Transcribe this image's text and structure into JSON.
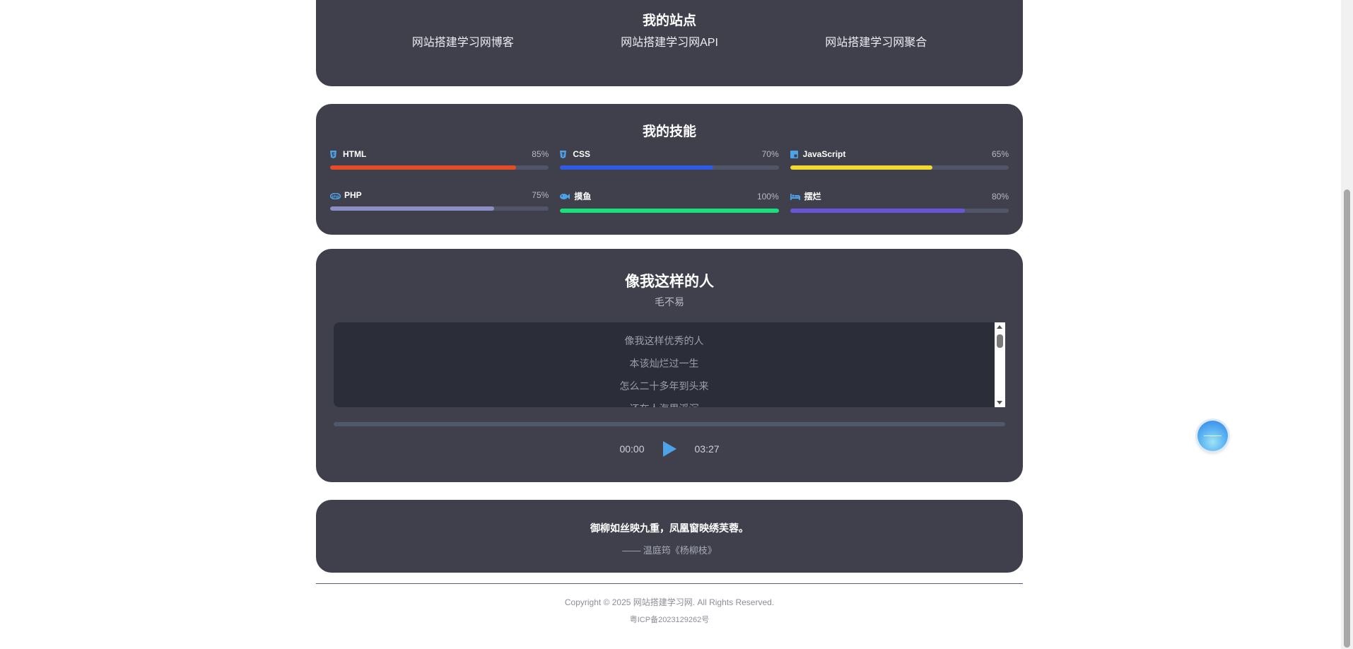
{
  "sites": {
    "title": "我的站点",
    "links": [
      "网站搭建学习网博客",
      "网站搭建学习网API",
      "网站搭建学习网聚合"
    ]
  },
  "skills": {
    "title": "我的技能",
    "items": [
      {
        "name": "HTML",
        "percent_label": "85%",
        "level": 85,
        "color": "#e44d26",
        "icon": "html5-icon"
      },
      {
        "name": "CSS",
        "percent_label": "70%",
        "level": 70,
        "color": "#2d5be3",
        "icon": "css3-icon"
      },
      {
        "name": "JavaScript",
        "percent_label": "65%",
        "level": 65,
        "color": "#f0db2e",
        "icon": "javascript-icon"
      },
      {
        "name": "PHP",
        "percent_label": "75%",
        "level": 75,
        "color": "#8c8fc4",
        "icon": "php-icon"
      },
      {
        "name": "摸鱼",
        "percent_label": "100%",
        "level": 100,
        "color": "#19e07a",
        "icon": "fish-icon"
      },
      {
        "name": "摆烂",
        "percent_label": "80%",
        "level": 80,
        "color": "#6a55d8",
        "icon": "bed-icon"
      }
    ]
  },
  "music": {
    "title": "像我这样的人",
    "artist": "毛不易",
    "lyrics": [
      "像我这样优秀的人",
      "本该灿烂过一生",
      "怎么二十多年到头来",
      "还在人海里浮沉"
    ],
    "current_time": "00:00",
    "total_time": "03:27",
    "progress": 0
  },
  "quote": {
    "text": "御柳如丝映九重，凤凰窗映绣芙蓉。",
    "source": "—— 温庭筠《杨柳枝》"
  },
  "footer": {
    "copyright": "Copyright © 2025 网站搭建学习网. All Rights Reserved.",
    "icp": "粤ICP备2023129262号"
  }
}
